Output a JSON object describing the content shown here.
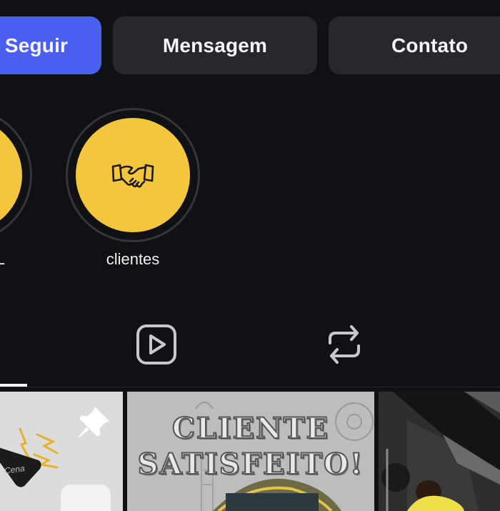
{
  "actions": {
    "follow_label": "Seguir",
    "message_label": "Mensagem",
    "contact_label": "Contato",
    "follow_color": "#4a5ef0",
    "secondary_color": "#26282d"
  },
  "highlights": [
    {
      "label": "EL",
      "color": "#f4c63d",
      "icon": "none"
    },
    {
      "label": "clientes",
      "color": "#f4c63d",
      "icon": "handshake-icon"
    }
  ],
  "tabs": [
    {
      "icon": "grid-icon",
      "active": true
    },
    {
      "icon": "reels-icon",
      "active": false
    },
    {
      "icon": "repost-icon",
      "active": false
    }
  ],
  "posts": [
    {
      "pinned": true,
      "icon": "pin-icon",
      "overlay_text": "Cena"
    },
    {
      "overlay_text_line1": "CLIENTE",
      "overlay_text_line2": "SATISFEITO!"
    },
    {
      "overlay_text": ""
    }
  ]
}
